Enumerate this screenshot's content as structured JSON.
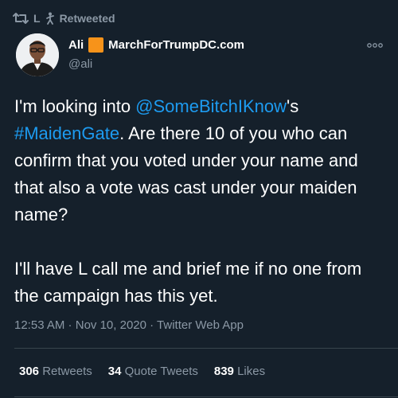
{
  "retweet_context": {
    "user": "L",
    "label": "Retweeted"
  },
  "author": {
    "name": "Ali",
    "name_suffix": "MarchForTrumpDC.com",
    "handle": "@ali"
  },
  "tweet": {
    "para1": {
      "t1": "I'm looking into ",
      "mention": "@SomeBitchIKnow",
      "t2": "'s",
      "hashtag": "#MaidenGate",
      "t3": ". Are there 10 of you who can confirm that you voted under your name and that also a vote was cast under your maiden name?"
    },
    "para2": "I'll have L call me and brief me if no one from the campaign has this yet."
  },
  "meta": {
    "time": "12:53 AM",
    "sep1": " · ",
    "date": "Nov 10, 2020",
    "sep2": " · ",
    "client": "Twitter Web App"
  },
  "stats": {
    "retweets_count": "306",
    "retweets_label": "Retweets",
    "quotes_count": "34",
    "quotes_label": "Quote Tweets",
    "likes_count": "839",
    "likes_label": "Likes"
  },
  "colors": {
    "background": "#15202b",
    "link": "#1d9bf0",
    "muted": "#8b98a5",
    "emoji_square": "#f7931a"
  },
  "icons": {
    "retweet": "retweet-icon",
    "context": "walking-figure-icon",
    "more": "more-options-icon"
  }
}
